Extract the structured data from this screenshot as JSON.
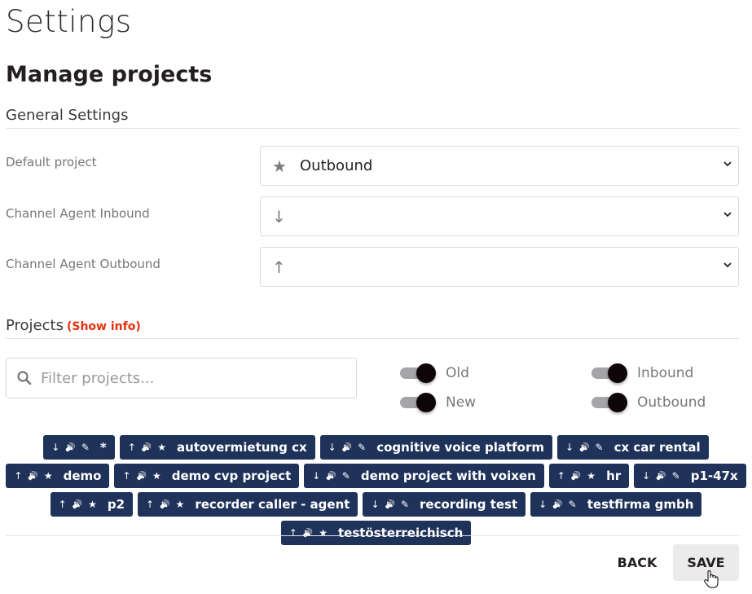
{
  "header": {
    "title": "Settings",
    "subtitle": "Manage projects"
  },
  "general_settings": {
    "heading": "General Settings",
    "fields": [
      {
        "label": "Default project",
        "icon": "star-icon",
        "icon_glyph": "★",
        "value": "Outbound"
      },
      {
        "label": "Channel Agent Inbound",
        "icon": "arrow-down-icon",
        "icon_glyph": "↓",
        "value": ""
      },
      {
        "label": "Channel Agent Outbound",
        "icon": "arrow-up-icon",
        "icon_glyph": "↑",
        "value": ""
      }
    ]
  },
  "projects": {
    "heading": "Projects",
    "show_info": "(Show info)",
    "filter_placeholder": "Filter projects...",
    "filter_value": "",
    "toggles": [
      {
        "label": "Old",
        "on": true
      },
      {
        "label": "New",
        "on": true
      },
      {
        "label": "Inbound",
        "on": true
      },
      {
        "label": "Outbound",
        "on": true
      }
    ],
    "chips": [
      {
        "direction": "↓",
        "sound": "🔊",
        "type": "✎",
        "name": "*"
      },
      {
        "direction": "↑",
        "sound": "🔊",
        "type": "★",
        "name": "autovermietung cx"
      },
      {
        "direction": "↓",
        "sound": "🔊",
        "type": "✎",
        "name": "cognitive voice platform"
      },
      {
        "direction": "↓",
        "sound": "🔊",
        "type": "✎",
        "name": "cx car rental"
      },
      {
        "direction": "↑",
        "sound": "🔊",
        "type": "★",
        "name": "demo"
      },
      {
        "direction": "↑",
        "sound": "🔊",
        "type": "★",
        "name": "demo cvp project"
      },
      {
        "direction": "↓",
        "sound": "🔊",
        "type": "✎",
        "name": "demo project with voixen"
      },
      {
        "direction": "↑",
        "sound": "🔊",
        "type": "★",
        "name": "hr"
      },
      {
        "direction": "↓",
        "sound": "🔊",
        "type": "✎",
        "name": "p1-47x"
      },
      {
        "direction": "↑",
        "sound": "🔊",
        "type": "★",
        "name": "p2"
      },
      {
        "direction": "↑",
        "sound": "🔊",
        "type": "★",
        "name": "recorder caller - agent"
      },
      {
        "direction": "↓",
        "sound": "🔊",
        "type": "✎",
        "name": "recording test"
      },
      {
        "direction": "↓",
        "sound": "🔊",
        "type": "✎",
        "name": "testfirma gmbh"
      },
      {
        "direction": "↑",
        "sound": "🔊",
        "type": "★",
        "name": "testösterreichisch"
      }
    ]
  },
  "footer": {
    "back_label": "BACK",
    "save_label": "SAVE"
  },
  "colors": {
    "chip_bg": "#1f325a",
    "accent_link": "#e8300f",
    "toggle_thumb": "#0e0509"
  }
}
